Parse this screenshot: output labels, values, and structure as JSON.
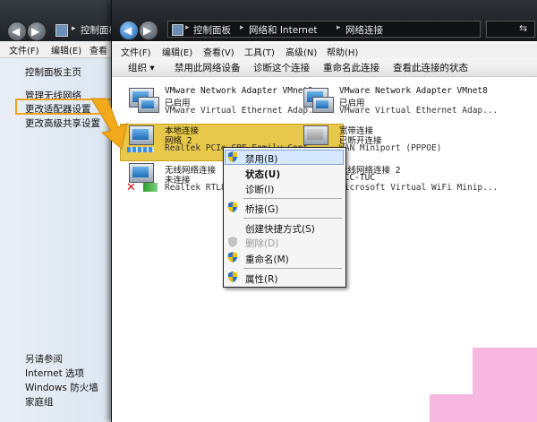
{
  "back_window": {
    "breadcrumb": "控制面板",
    "menu": [
      "文件(F)",
      "编辑(E)",
      "查看"
    ],
    "sidebar": {
      "links": [
        "控制面板主页",
        "管理无线网络",
        "更改适配器设置",
        "更改高级共享设置"
      ],
      "see_also_title": "另请参阅",
      "see_also": [
        "Internet 选项",
        "Windows 防火墙",
        "家庭组"
      ]
    }
  },
  "front_window": {
    "breadcrumbs": [
      "控制面板",
      "网络和 Internet",
      "网络连接"
    ],
    "menu": [
      "文件(F)",
      "编辑(E)",
      "查看(V)",
      "工具(T)",
      "高级(N)",
      "帮助(H)"
    ],
    "toolbar": [
      "组织 ▾",
      "禁用此网络设备",
      "诊断这个连接",
      "重命名此连接",
      "查看此连接的状态"
    ],
    "adapters": [
      {
        "name": "VMware Network Adapter VMnet1",
        "status": "已启用",
        "device": "VMware Virtual Ethernet Adap..."
      },
      {
        "name": "VMware Network Adapter VMnet8",
        "status": "已启用",
        "device": "VMware Virtual Ethernet Adap..."
      },
      {
        "name": "本地连接",
        "status": "网络  2",
        "device": "Realtek PCIe GBE Family Cont..."
      },
      {
        "name": "宽带连接",
        "status": "已断开连接",
        "device": "WAN Miniport (PPPOE)"
      },
      {
        "name": "无线网络连接",
        "status": "未连接",
        "device": "Realtek RTL819..."
      },
      {
        "name": "无线网络连接 2",
        "status": "ACC-TUC",
        "device": "Microsoft Virtual WiFi Minip..."
      }
    ]
  },
  "context_menu": {
    "items": [
      {
        "label": "禁用(B)",
        "bold": false,
        "enabled": true
      },
      {
        "label": "状态(U)",
        "bold": true,
        "enabled": true
      },
      {
        "label": "诊断(I)",
        "bold": false,
        "enabled": true
      },
      {
        "label": "桥接(G)",
        "bold": false,
        "enabled": true
      },
      {
        "label": "创建快捷方式(S)",
        "bold": false,
        "enabled": true
      },
      {
        "label": "删除(D)",
        "bold": false,
        "enabled": false
      },
      {
        "label": "重命名(M)",
        "bold": false,
        "enabled": true
      },
      {
        "label": "属性(R)",
        "bold": false,
        "enabled": true
      }
    ]
  },
  "colors": {
    "highlight_box": "#f0a321",
    "arrow": "#f2a91c",
    "selection": "#e8c84a"
  }
}
